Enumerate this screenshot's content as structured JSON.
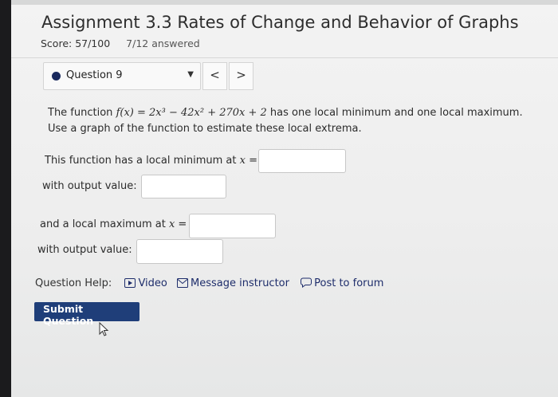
{
  "header": {
    "title": "Assignment 3.3 Rates of Change and Behavior of Graphs",
    "score": "Score: 57/100",
    "answered": "7/12 answered"
  },
  "question_nav": {
    "label": "Question 9",
    "prev": "<",
    "next": ">"
  },
  "problem": {
    "intro": "The function ",
    "formula": "f(x) = 2x³ − 42x² + 270x + 2",
    "rest": " has one local minimum and one local maximum.",
    "line2": "Use a graph of the function to estimate these local extrema."
  },
  "fields": {
    "min_prompt_prefix": "This function has a local minimum at ",
    "min_var": "x",
    "min_prompt_suffix": " =",
    "min_output_label": "with output value:",
    "max_prompt_prefix": "and a local maximum at ",
    "max_var": "x",
    "max_prompt_suffix": " =",
    "max_output_label": "with output value:",
    "min_x_value": "",
    "min_output_value": "",
    "max_x_value": "",
    "max_output_value": ""
  },
  "help": {
    "label": "Question Help:",
    "video": "Video",
    "message": "Message instructor",
    "forum": "Post to forum"
  },
  "submit_label": "Submit Question"
}
